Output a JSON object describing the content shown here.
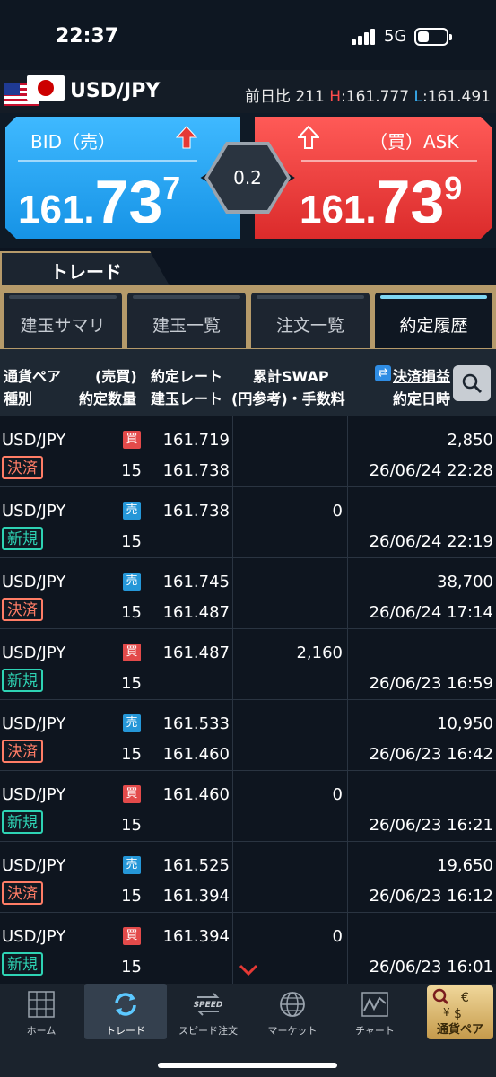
{
  "status_bar": {
    "time": "22:37",
    "network": "5G"
  },
  "pair": {
    "name": "USD/JPY",
    "change_label": "前日比",
    "change_value": "211",
    "high_label": "H",
    "high_value": "161.777",
    "low_label": "L",
    "low_value": "161.491"
  },
  "bid": {
    "label": "BID（売）",
    "price_small": "161.",
    "price_big": "73",
    "price_pip": "7"
  },
  "ask": {
    "label": "（買）ASK",
    "price_small": "161.",
    "price_big": "73",
    "price_pip": "9"
  },
  "spread": "0.2",
  "trade_tab": "トレード",
  "subtabs": [
    {
      "label": "建玉サマリ",
      "active": false
    },
    {
      "label": "建玉一覧",
      "active": false
    },
    {
      "label": "注文一覧",
      "active": false
    },
    {
      "label": "約定履歴",
      "active": true
    }
  ],
  "table_headers": {
    "pair": "通貨ペア",
    "kind": "種別",
    "side": "(売買)",
    "qty": "約定数量",
    "rate1": "約定レート",
    "rate2": "建玉レート",
    "swap1": "累計SWAP",
    "swap2": "(円参考)・手数料",
    "pnl": "決済損益",
    "date": "約定日時"
  },
  "rows": [
    {
      "pair": "USD/JPY",
      "kind": "決済",
      "kind_type": "settle",
      "side": "買",
      "side_type": "buy",
      "qty": "15",
      "rate1": "161.719",
      "rate2": "161.738",
      "swap": "",
      "pnl": "2,850",
      "date": "26/06/24 22:28"
    },
    {
      "pair": "USD/JPY",
      "kind": "新規",
      "kind_type": "new",
      "side": "売",
      "side_type": "sell",
      "qty": "15",
      "rate1": "161.738",
      "rate2": "",
      "swap": "0",
      "pnl": "",
      "date": "26/06/24 22:19"
    },
    {
      "pair": "USD/JPY",
      "kind": "決済",
      "kind_type": "settle",
      "side": "売",
      "side_type": "sell",
      "qty": "15",
      "rate1": "161.745",
      "rate2": "161.487",
      "swap": "",
      "pnl": "38,700",
      "date": "26/06/24 17:14"
    },
    {
      "pair": "USD/JPY",
      "kind": "新規",
      "kind_type": "new",
      "side": "買",
      "side_type": "buy",
      "qty": "15",
      "rate1": "161.487",
      "rate2": "",
      "swap": "2,160",
      "pnl": "",
      "date": "26/06/23 16:59"
    },
    {
      "pair": "USD/JPY",
      "kind": "決済",
      "kind_type": "settle",
      "side": "売",
      "side_type": "sell",
      "qty": "15",
      "rate1": "161.533",
      "rate2": "161.460",
      "swap": "",
      "pnl": "10,950",
      "date": "26/06/23 16:42"
    },
    {
      "pair": "USD/JPY",
      "kind": "新規",
      "kind_type": "new",
      "side": "買",
      "side_type": "buy",
      "qty": "15",
      "rate1": "161.460",
      "rate2": "",
      "swap": "0",
      "pnl": "",
      "date": "26/06/23 16:21"
    },
    {
      "pair": "USD/JPY",
      "kind": "決済",
      "kind_type": "settle",
      "side": "売",
      "side_type": "sell",
      "qty": "15",
      "rate1": "161.525",
      "rate2": "161.394",
      "swap": "",
      "pnl": "19,650",
      "date": "26/06/23 16:12"
    },
    {
      "pair": "USD/JPY",
      "kind": "新規",
      "kind_type": "new",
      "side": "買",
      "side_type": "buy",
      "qty": "15",
      "rate1": "161.394",
      "rate2": "",
      "swap": "0",
      "pnl": "",
      "date": "26/06/23 16:01"
    }
  ],
  "nav": {
    "home": "ホーム",
    "trade": "トレード",
    "speed_order": "スピード注文",
    "speed_badge": "SPEED",
    "market": "マーケット",
    "chart": "チャート",
    "currency_pair": "通貨ペア"
  },
  "colors": {
    "bid": "#1b9cf0",
    "ask": "#e23a3a",
    "settle": "#ff7d66",
    "new": "#2ed3b4",
    "gold": "#b59a6a"
  }
}
